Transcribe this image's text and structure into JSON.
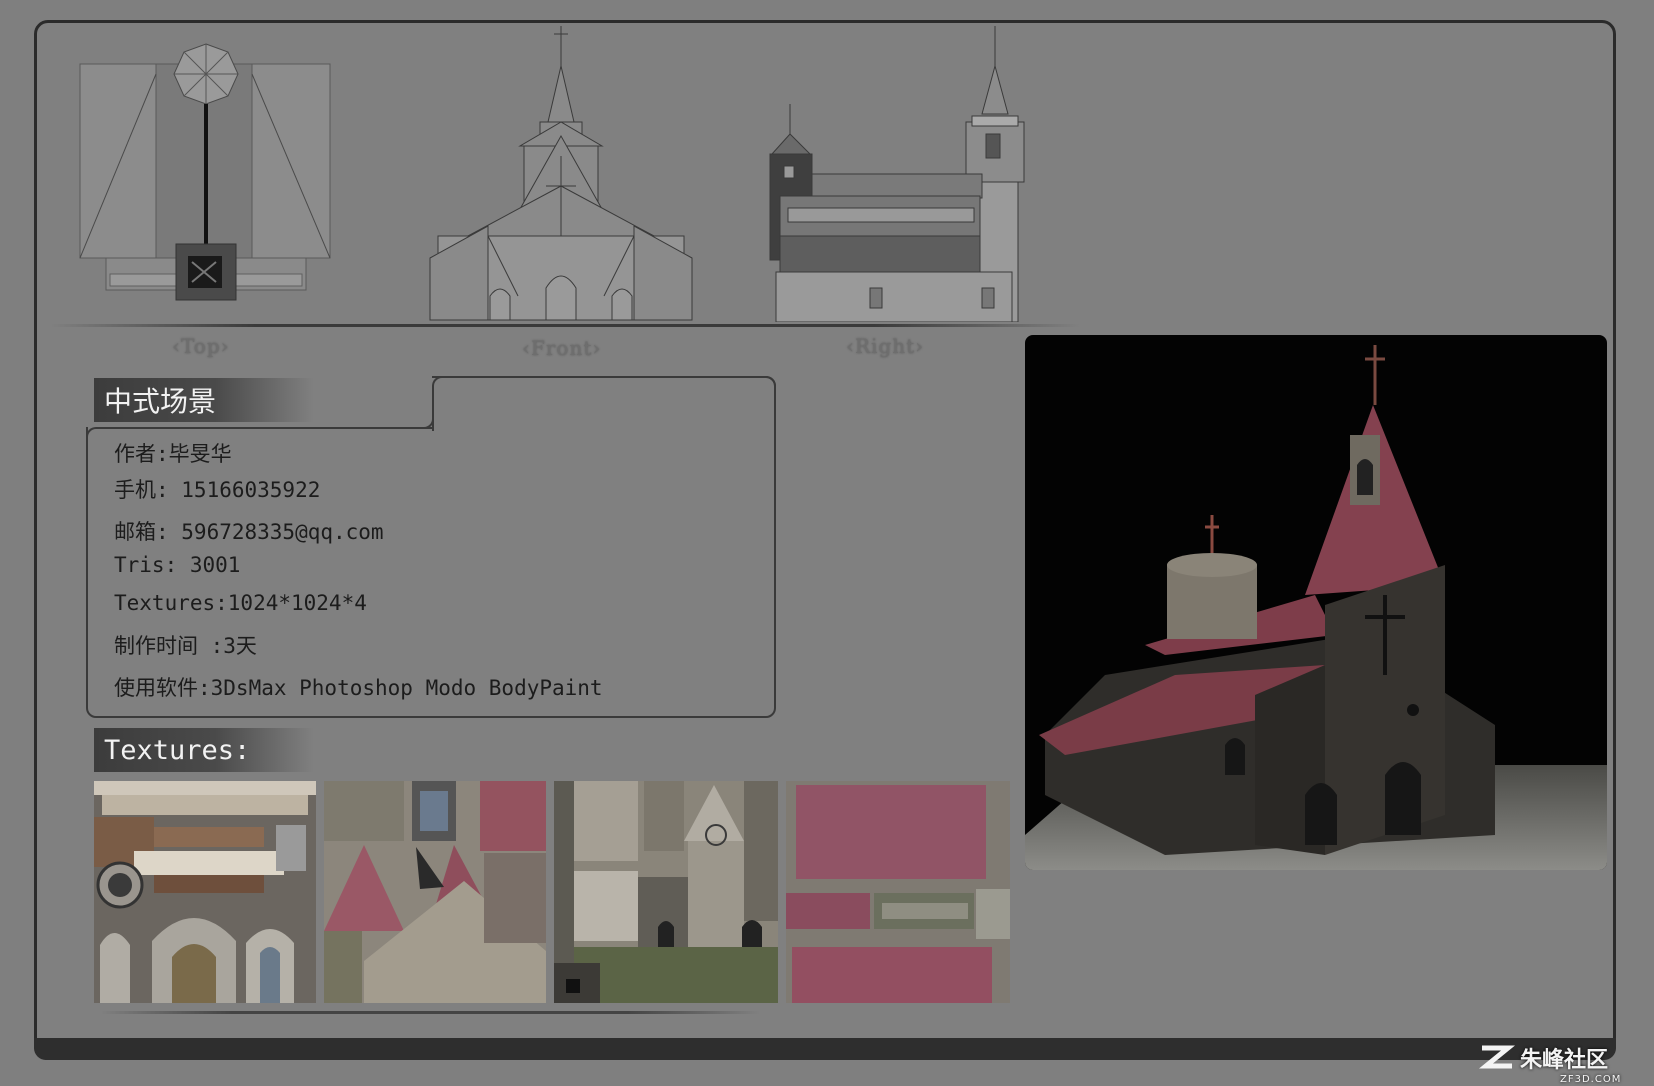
{
  "views": {
    "top_label": "‹Top›",
    "front_label": "‹Front›",
    "right_label": "‹Right›"
  },
  "info": {
    "title": "中式场景",
    "author": "作者:毕旻华",
    "phone": "手机: 15166035922",
    "email": "邮箱: 596728335@qq.com",
    "tris": "Tris: 3001",
    "textures": "Textures:1024*1024*4",
    "time": "制作时间 :3天",
    "software": "使用软件:3DsMax Photoshop Modo BodyPaint"
  },
  "textures_section": {
    "title": "Textures:"
  },
  "watermark": {
    "brand": "朱峰社区",
    "domain": "ZF3D.COM"
  },
  "colors": {
    "background": "#808080",
    "frame": "#2b2b2b",
    "roof": "#8a4a55",
    "stone": "#4a4a4a"
  }
}
